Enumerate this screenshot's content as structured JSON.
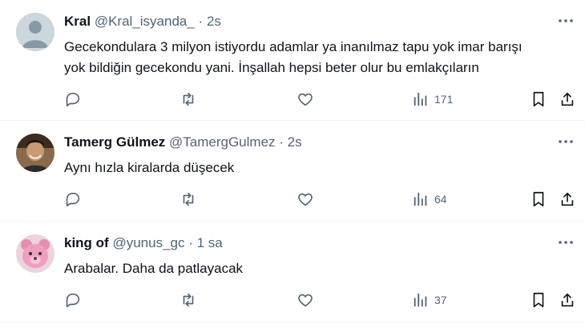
{
  "posts": [
    {
      "name": "Kral",
      "handle": "@Kral_isyanda_",
      "dot": "·",
      "time": "2s",
      "text_line1": "Gecekondulara 3 milyon istiyordu adamlar ya inanılmaz tapu yok imar barışı",
      "text_line2": "yok bildiğin gecekondu yani. İnşallah hepsi beter olur bu emlakçıların",
      "views": "171",
      "avatar_icon": "default-avatar-icon"
    },
    {
      "name": "Tamerg Gülmez",
      "handle": "@TamergGulmez",
      "dot": "·",
      "time": "2s",
      "text_line1": "Aynı hızla kiralarda düşecek",
      "views": "64",
      "avatar_icon": "profile-photo"
    },
    {
      "name": "king of",
      "handle": "@yunus_gc",
      "dot": "·",
      "time": "1 sa",
      "text_line1": "Arabalar. Daha da patlayacak",
      "views": "37",
      "avatar_icon": "pink-bear-avatar"
    }
  ],
  "icons": {
    "reply": "reply-icon",
    "repost": "repost-icon",
    "like": "like-icon",
    "views": "views-icon",
    "bookmark": "bookmark-icon",
    "share": "share-icon",
    "more": "more-icon"
  },
  "colors": {
    "text": "#0f1419",
    "secondary": "#536471",
    "divider": "#eff3f4"
  }
}
